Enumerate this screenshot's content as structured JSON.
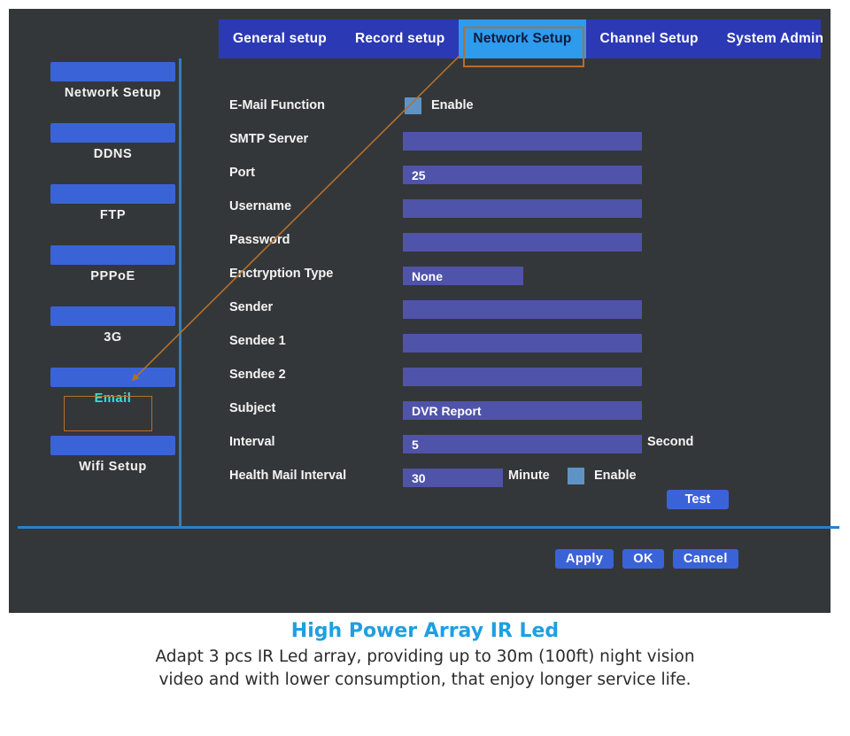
{
  "tabs": [
    {
      "label": "General setup",
      "active": false
    },
    {
      "label": "Record setup",
      "active": false
    },
    {
      "label": "Network Setup",
      "active": true
    },
    {
      "label": "Channel Setup",
      "active": false
    },
    {
      "label": "System Admin",
      "active": false
    }
  ],
  "sidebar": {
    "items": [
      {
        "label": "Network  Setup",
        "selected": false
      },
      {
        "label": "DDNS",
        "selected": false
      },
      {
        "label": "FTP",
        "selected": false
      },
      {
        "label": "PPPoE",
        "selected": false
      },
      {
        "label": "3G",
        "selected": false
      },
      {
        "label": "Email",
        "selected": true
      },
      {
        "label": "Wifi Setup",
        "selected": false
      }
    ]
  },
  "form": {
    "email_function": {
      "label": "E-Mail Function",
      "checkbox_label": "Enable",
      "checked": true
    },
    "smtp_server": {
      "label": "SMTP Server",
      "value": ""
    },
    "port": {
      "label": "Port",
      "value": "25"
    },
    "username": {
      "label": "Username",
      "value": ""
    },
    "password": {
      "label": "Password",
      "value": ""
    },
    "encryption_type": {
      "label": "Enctryption Type",
      "value": "None"
    },
    "sender": {
      "label": "Sender",
      "value": ""
    },
    "sendee1": {
      "label": "Sendee 1",
      "value": ""
    },
    "sendee2": {
      "label": "Sendee 2",
      "value": ""
    },
    "subject": {
      "label": "Subject",
      "value": "DVR Report"
    },
    "interval": {
      "label": "Interval",
      "value": "5",
      "unit": "Second"
    },
    "health_mail_interval": {
      "label": "Health Mail Interval",
      "value": "30",
      "unit": "Minute",
      "checkbox_label": "Enable",
      "checked": true
    },
    "test_button": "Test"
  },
  "actions": {
    "apply": "Apply",
    "ok": "OK",
    "cancel": "Cancel"
  },
  "caption": {
    "title": "High Power Array IR Led",
    "line1": "Adapt 3 pcs IR Led array, providing up to 30m (100ft) night vision",
    "line2": "video and with lower consumption, that enjoy longer service life."
  },
  "colors": {
    "panel_bg": "#343739",
    "tabbar_bg": "#2b39b5",
    "tab_active_bg": "#2e9bec",
    "divider_blue": "#2d7fc4",
    "button_blue": "#3b63d8",
    "input_blue": "#4f53aa",
    "checkbox_blue": "#5f93c6",
    "highlight_orange": "#b2702e",
    "selected_cyan": "#2ee6e6",
    "caption_title": "#1f9fe0"
  }
}
